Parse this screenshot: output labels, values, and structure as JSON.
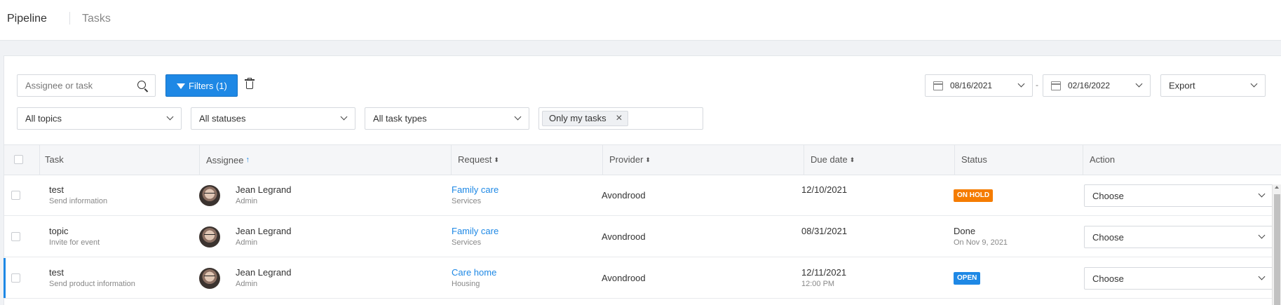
{
  "nav": {
    "active": "Pipeline",
    "item": "Tasks"
  },
  "toolbar": {
    "search_placeholder": "Assignee or task",
    "filters_label": "Filters (1)",
    "date_from": "08/16/2021",
    "date_to": "02/16/2022",
    "date_separator": "-",
    "export_label": "Export"
  },
  "filters": {
    "topics": "All topics",
    "statuses": "All statuses",
    "task_types": "All task types",
    "tag": "Only my tasks",
    "tag_remove": "×"
  },
  "table": {
    "headers": {
      "task": "Task",
      "assignee": "Assignee",
      "request": "Request",
      "provider": "Provider",
      "due_date": "Due date",
      "status": "Status",
      "action": "Action"
    },
    "rows": [
      {
        "task": "test",
        "task_sub": "Send information",
        "assignee": "Jean Legrand",
        "assignee_role": "Admin",
        "request": "Family care",
        "request_sub": "Services",
        "provider": "Avondrood",
        "due": "12/10/2021",
        "due_sub": "",
        "status_badge": "ON HOLD",
        "status_color": "#f57c00",
        "action": "Choose"
      },
      {
        "task": "topic",
        "task_sub": "Invite for event",
        "assignee": "Jean Legrand",
        "assignee_role": "Admin",
        "request": "Family care",
        "request_sub": "Services",
        "provider": "Avondrood",
        "due": "08/31/2021",
        "due_sub": "",
        "status_text": "Done",
        "status_sub": "On Nov 9, 2021",
        "action": "Choose"
      },
      {
        "task": "test",
        "task_sub": "Send product information",
        "assignee": "Jean Legrand",
        "assignee_role": "Admin",
        "request": "Care home",
        "request_sub": "Housing",
        "provider": "Avondrood",
        "due": "12/11/2021",
        "due_sub": "12:00 PM",
        "status_badge": "OPEN",
        "status_color": "#1e88e5",
        "action": "Choose"
      }
    ]
  },
  "icons": [
    "search-icon",
    "funnel-icon",
    "trash-icon",
    "calendar-icon",
    "chevron-down-icon",
    "sort-icon",
    "sort-up-icon",
    "close-icon"
  ]
}
